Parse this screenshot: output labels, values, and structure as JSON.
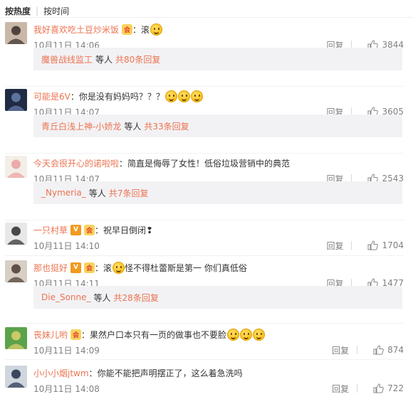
{
  "sort": {
    "hot": "按热度",
    "time": "按时间"
  },
  "labels": {
    "reply": "回复",
    "colon": "：",
    "and_others": "等人",
    "total_prefix": "共",
    "total_suffix": "条回复"
  },
  "comments": [
    {
      "user": "我好喜欢吃土豆炒米饭",
      "badges": [
        "member"
      ],
      "text": "滚",
      "emoji_count": 1,
      "after_emoji": "",
      "time": "10月11日 14:06",
      "likes": "3844",
      "reply_user": "魔兽战线监工",
      "reply_total": "80"
    },
    {
      "user": "可能是6V",
      "badges": [],
      "text": "你是没有妈妈吗？？？",
      "emoji_count": 3,
      "after_emoji": "",
      "time": "10月11日 14:07",
      "likes": "3605",
      "reply_user": "青丘白浅上神-小娇龙",
      "reply_total": "33"
    },
    {
      "user": "今天会很开心的诺啦啦",
      "badges": [],
      "text": "简直是侮辱了女性！低俗垃圾营销中的典范",
      "emoji_count": 0,
      "after_emoji": "",
      "time": "10月11日 14:07",
      "likes": "2543",
      "reply_user": "_Nymeria_",
      "reply_total": "7"
    },
    {
      "user": "一只村草",
      "badges": [
        "v",
        "member"
      ],
      "text": "祝早日倒闭❢",
      "emoji_count": 0,
      "after_emoji": "",
      "time": "10月11日 14:10",
      "likes": "1704",
      "reply_user": "",
      "reply_total": ""
    },
    {
      "user": "那也挺好",
      "badges": [
        "v",
        "member"
      ],
      "text": "滚",
      "emoji_count": 1,
      "after_emoji": " 怪不得杜蕾斯是第一 你们真低俗",
      "time": "10月11日 14:11",
      "likes": "1477",
      "reply_user": "Die_Sonne_",
      "reply_total": "28"
    },
    {
      "user": "丧妹儿哟",
      "badges": [
        "member"
      ],
      "text": "果然户口本只有一页的做事也不要脸",
      "emoji_count": 3,
      "after_emoji": "",
      "time": "10月11日 14:09",
      "likes": "874",
      "reply_user": "",
      "reply_total": ""
    },
    {
      "user": "小小小烟jtwm",
      "badges": [],
      "text": "你能不能把声明摆正了，这么着急洗吗",
      "emoji_count": 0,
      "after_emoji": "",
      "time": "10月11日 14:08",
      "likes": "722",
      "reply_user": "",
      "reply_total": ""
    }
  ],
  "colors": {
    "username": "#eb7350",
    "meta": "#808080",
    "reply_bg": "#f2f2f5"
  }
}
